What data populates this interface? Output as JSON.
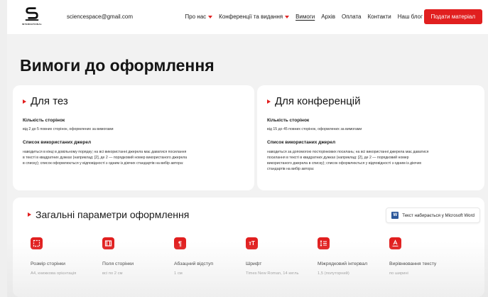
{
  "header": {
    "logo_text": "INTERNATIONAL",
    "email": "sciencespace@gmail.com",
    "nav": [
      {
        "label": "Про нас",
        "dropdown": true,
        "active": false
      },
      {
        "label": "Конференції та видання",
        "dropdown": true,
        "active": false
      },
      {
        "label": "Вимоги",
        "dropdown": false,
        "active": true
      },
      {
        "label": "Архів",
        "dropdown": false,
        "active": false
      },
      {
        "label": "Оплата",
        "dropdown": false,
        "active": false
      },
      {
        "label": "Контакти",
        "dropdown": false,
        "active": false
      },
      {
        "label": "Наш блог",
        "dropdown": false,
        "active": false
      }
    ],
    "submit_label": "Подати матеріал"
  },
  "page_title": "Вимоги до оформлення",
  "thesis": {
    "title": "Для тез",
    "pages_heading": "Кількість сторінок",
    "pages_text": "від 2 до 5 повних сторінок, оформлених за вимогами",
    "sources_heading": "Список використаних джерел",
    "sources_lines": [
      "наводиться в кінці в довільному порядку; на всі використанні джерела має даватися посилання",
      "в тексті в квадратних дужках (наприклад: [2], де 2 — порядковий номер використаного джерела",
      "в списку); список оформлюється у відповідності з одним із діючих стандартів на вибір автора:"
    ]
  },
  "conferences": {
    "title": "Для конференцій",
    "pages_heading": "Кількість сторінок",
    "pages_text": "від 15 до 45 повних сторінок, оформлених за вимогами",
    "sources_heading": "Список використаних джерел",
    "sources_lines": [
      "наводиться за допомогою посторінкових посилань; на всі використанні джерела має даватися",
      "посилання в тексті в квадратних дужках (наприклад: [2], де 2 — порядковий номер",
      "використаного джерела в списку); список оформлюється у відповідності з одним із діючих",
      "стандартів на вибір автора:"
    ]
  },
  "general": {
    "title": "Загальні параметри оформлення",
    "word_badge": "Текст набирається у Microsoft Word",
    "params": [
      {
        "name": "Розмір сторінки",
        "value": "А4, книжкова орієнтація",
        "icon": "page-size-icon"
      },
      {
        "name": "Поля сторінки",
        "value": "всі по 2 см",
        "icon": "margins-icon"
      },
      {
        "name": "Абзацний відступ",
        "value": "1 см",
        "icon": "paragraph-icon"
      },
      {
        "name": "Шрифт",
        "value": "Times New Roman, 14 кегль",
        "icon": "font-icon"
      },
      {
        "name": "Міжрядковий інтервал",
        "value": "1,5 (полуторний)",
        "icon": "line-spacing-icon"
      },
      {
        "name": "Вирівнювання тексту",
        "value": "по ширині",
        "icon": "text-align-icon"
      }
    ]
  },
  "colors": {
    "accent": "#e11f1f",
    "word_blue": "#2b579a"
  }
}
